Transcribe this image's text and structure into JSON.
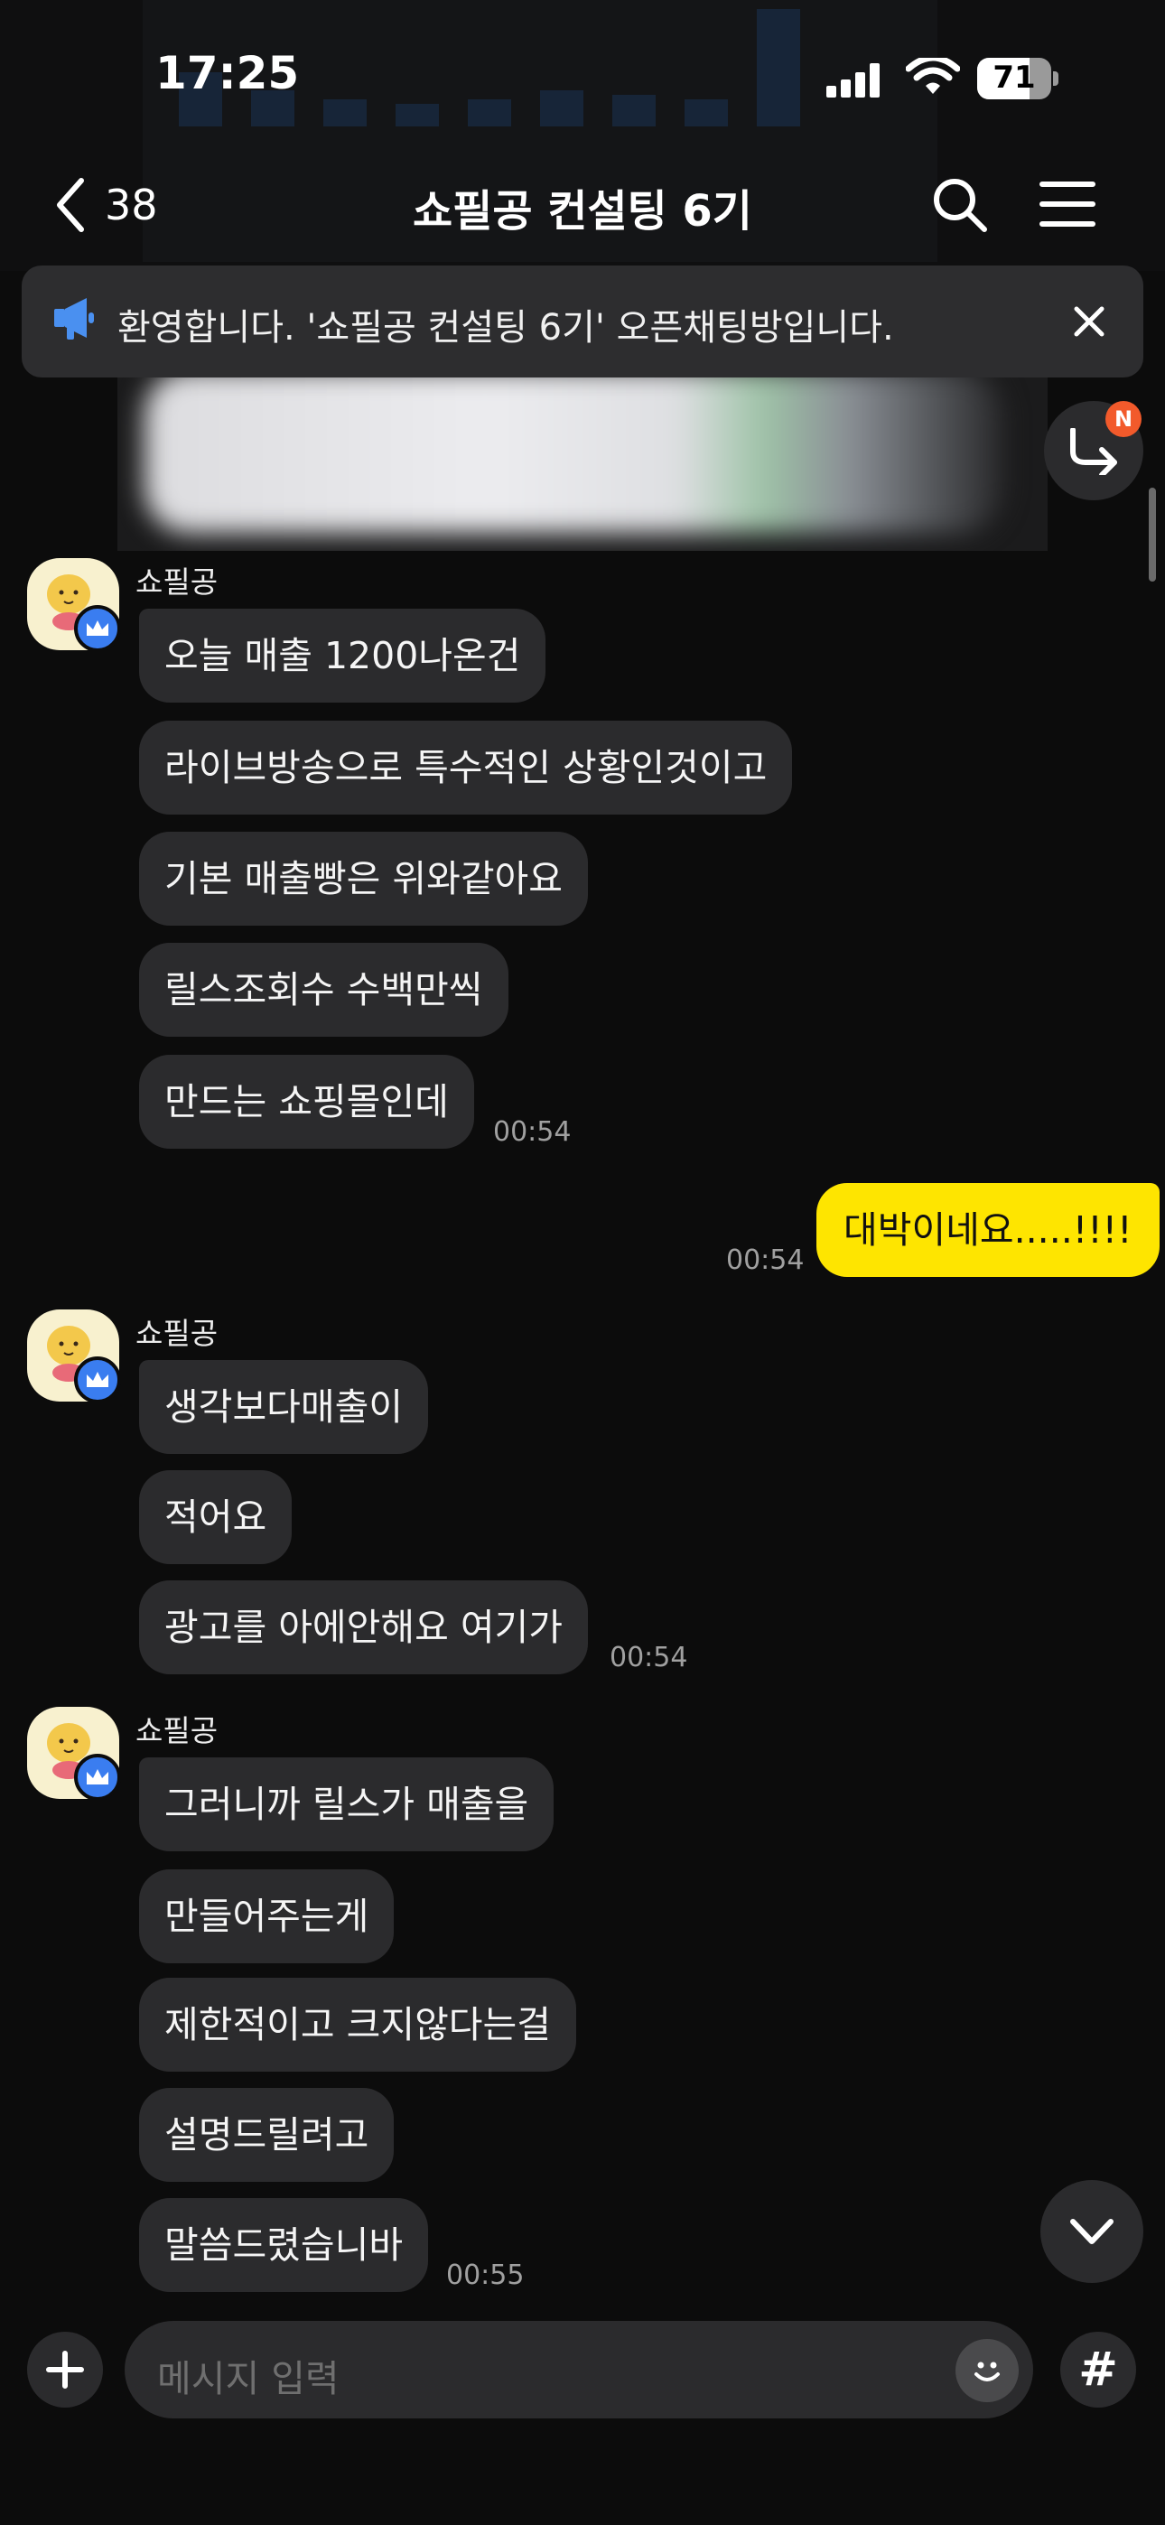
{
  "status_bar": {
    "time": "17:25",
    "battery": "71",
    "battery_level": 0.71
  },
  "nav": {
    "back_count": "38",
    "title": "쇼필공 컨설팅 6기"
  },
  "notice": {
    "text": "환영합니다. '쇼필공 컨설팅 6기' 오픈채팅방입니다."
  },
  "reply_badge": "N",
  "groups": [
    {
      "sender": "쇼필공",
      "messages": [
        "오늘 매출 1200나온건",
        "라이브방송으로 특수적인 상황인것이고",
        "기본 매출빵은 위와같아요",
        "릴스조회수 수백만씩",
        "만드는 쇼핑몰인데"
      ],
      "time": "00:54"
    },
    {
      "sender": "쇼필공",
      "messages": [
        "생각보다매출이",
        "적어요",
        "광고를 아에안해요 여기가"
      ],
      "time": "00:54"
    },
    {
      "sender": "쇼필공",
      "messages": [
        "그러니까 릴스가 매출을",
        "만들어주는게",
        "제한적이고 크지않다는걸",
        "설명드릴려고",
        "말씀드렸습니바"
      ],
      "time": "00:55"
    }
  ],
  "my_message": {
    "text": "대박이네요.....!!!!",
    "time": "00:54"
  },
  "input": {
    "placeholder": "메시지 입력",
    "hash_label": "#"
  },
  "colors": {
    "my_bubble": "#fee500",
    "their_bubble": "#2b2b2d",
    "badge": "#f25a2b",
    "crown": "#3a7df0"
  }
}
